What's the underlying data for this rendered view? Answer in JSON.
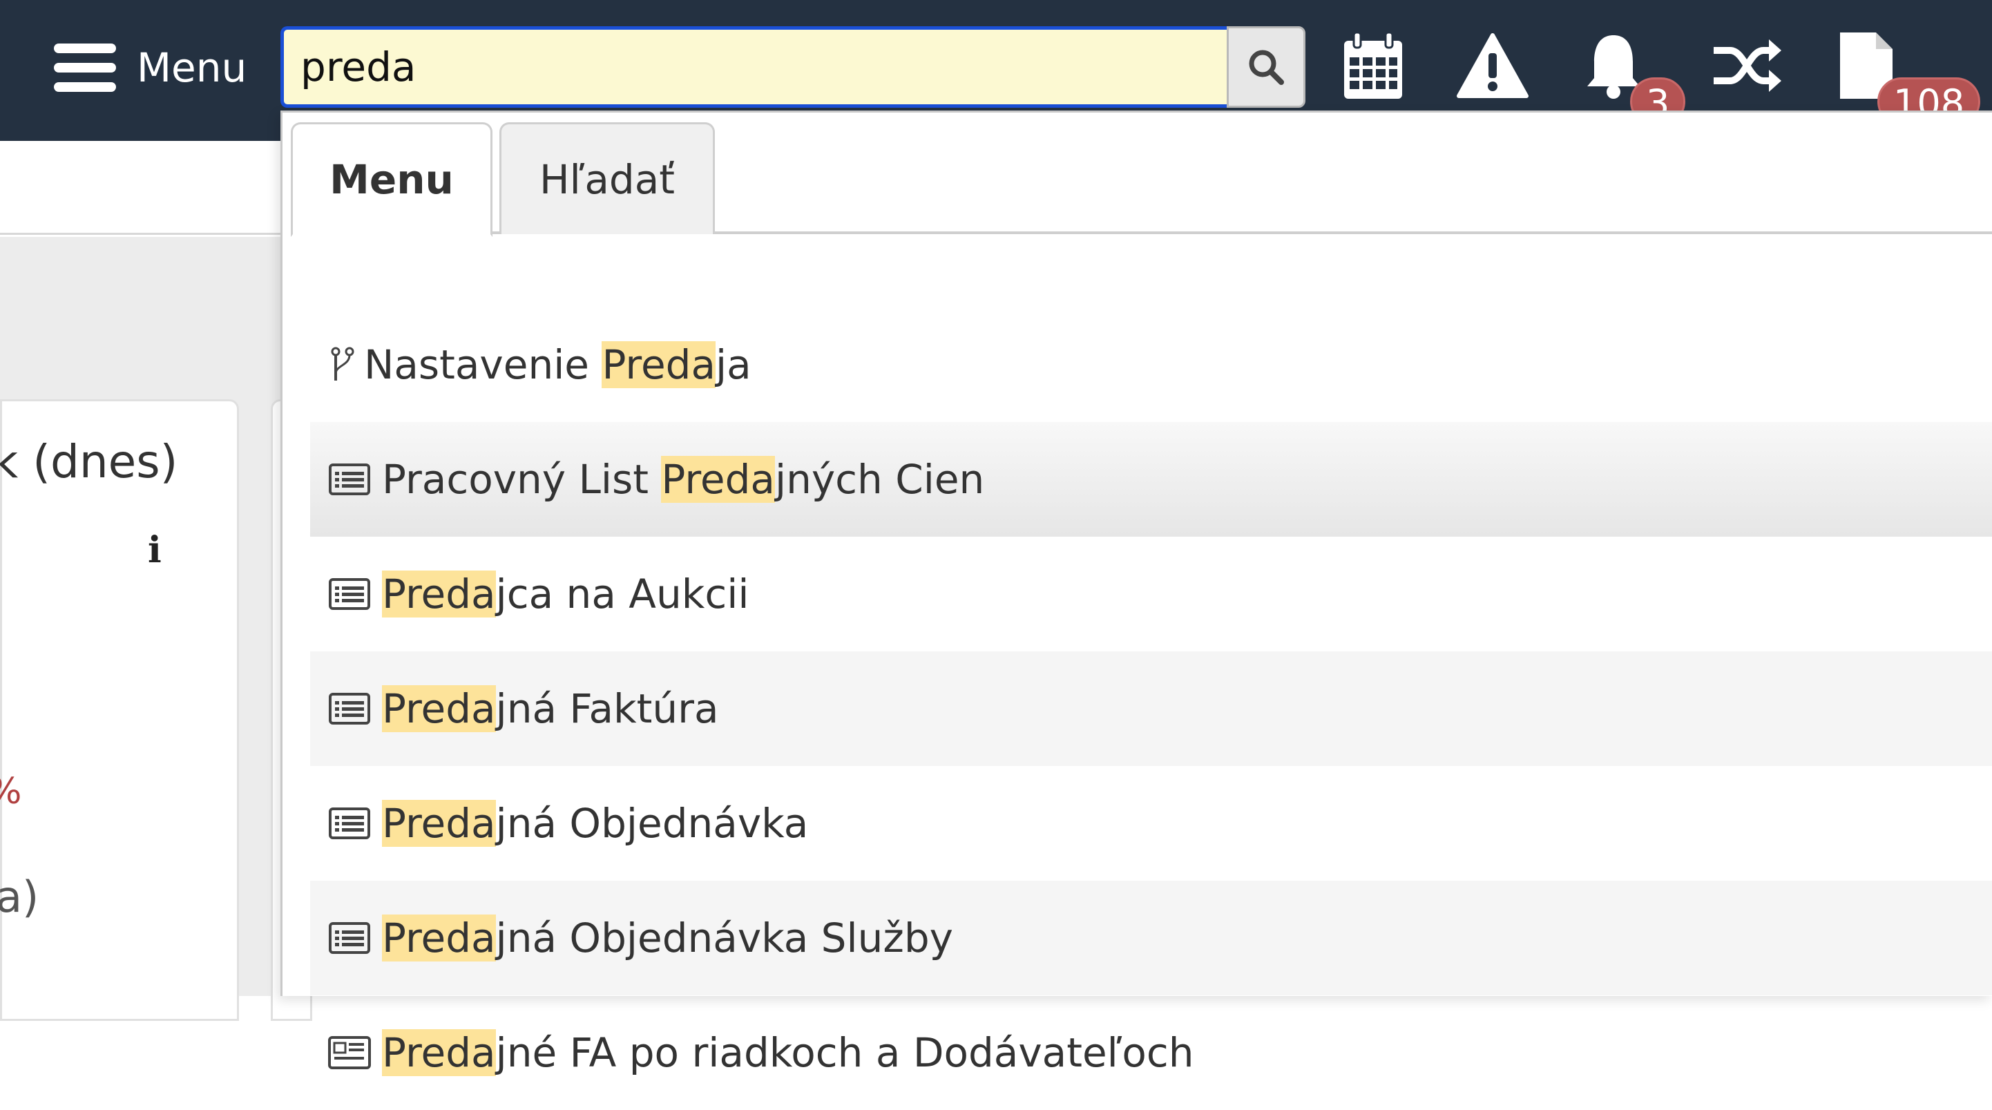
{
  "navbar": {
    "menu_label": "Menu",
    "search": {
      "value": "preda"
    },
    "icons": [
      {
        "name": "calendar-icon"
      },
      {
        "name": "warning-icon"
      },
      {
        "name": "bell-icon",
        "badge": "3"
      },
      {
        "name": "shuffle-icon"
      },
      {
        "name": "document-icon",
        "badge": "108"
      }
    ]
  },
  "background": {
    "card_title": "k (dnes)",
    "card_pct": "%",
    "card_text2": "a)"
  },
  "dropdown": {
    "tabs": [
      {
        "label": "Menu",
        "active": true
      },
      {
        "label": "Hľadať",
        "active": false
      }
    ],
    "results": [
      {
        "icon": "branch-icon",
        "before": "Nastavenie ",
        "match": "Preda",
        "after": "ja"
      },
      {
        "icon": "list-icon",
        "before": "Pracovný List ",
        "match": "Preda",
        "after": "jných Cien"
      },
      {
        "icon": "list-icon",
        "before": "",
        "match": "Preda",
        "after": "jca na Aukcii"
      },
      {
        "icon": "list-icon",
        "before": "",
        "match": "Preda",
        "after": "jná Faktúra"
      },
      {
        "icon": "list-icon",
        "before": "",
        "match": "Preda",
        "after": "jná Objednávka"
      },
      {
        "icon": "list-icon",
        "before": "",
        "match": "Preda",
        "after": "jná Objednávka Služby"
      },
      {
        "icon": "report-icon",
        "before": "",
        "match": "Preda",
        "after": "jné FA po riadkoch a Dodávateľoch"
      }
    ]
  },
  "colors": {
    "navbar_bg": "#243141",
    "search_bg": "#fcf9d2",
    "search_border": "#1a4fd6",
    "highlight": "#fde39a",
    "badge": "#b55353"
  }
}
